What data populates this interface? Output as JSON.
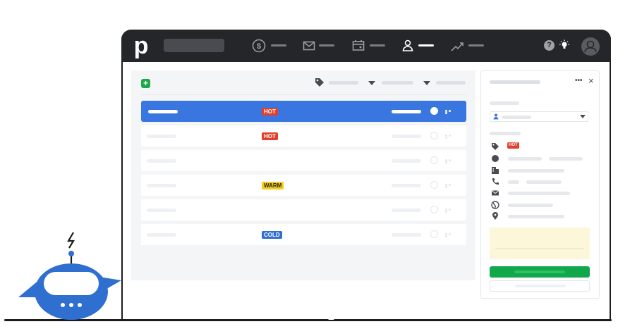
{
  "app": {
    "logo_text": "p"
  },
  "nav": [
    {
      "icon": "dollar-icon",
      "active": false
    },
    {
      "icon": "mail-icon",
      "active": false
    },
    {
      "icon": "calendar-icon",
      "active": false
    },
    {
      "icon": "contacts-icon",
      "active": true
    },
    {
      "icon": "trend-icon",
      "active": false
    }
  ],
  "header": {
    "help_label": "?"
  },
  "list": {
    "rows": [
      {
        "selected": true,
        "label": "HOT",
        "label_type": "hot"
      },
      {
        "selected": false,
        "label": "HOT",
        "label_type": "hot"
      },
      {
        "selected": false,
        "label": "",
        "label_type": ""
      },
      {
        "selected": false,
        "label": "WARM",
        "label_type": "warm"
      },
      {
        "selected": false,
        "label": "",
        "label_type": ""
      },
      {
        "selected": false,
        "label": "COLD",
        "label_type": "cold"
      }
    ]
  },
  "detail": {
    "tag_label": "HOT",
    "more_label": "•••",
    "close_label": "×"
  },
  "colors": {
    "selected_row": "#3a76e0",
    "hot": "#e0402b",
    "warm": "#f5cc17",
    "cold": "#2f6fd0",
    "primary_button": "#10a84a",
    "topbar": "#25262a"
  }
}
